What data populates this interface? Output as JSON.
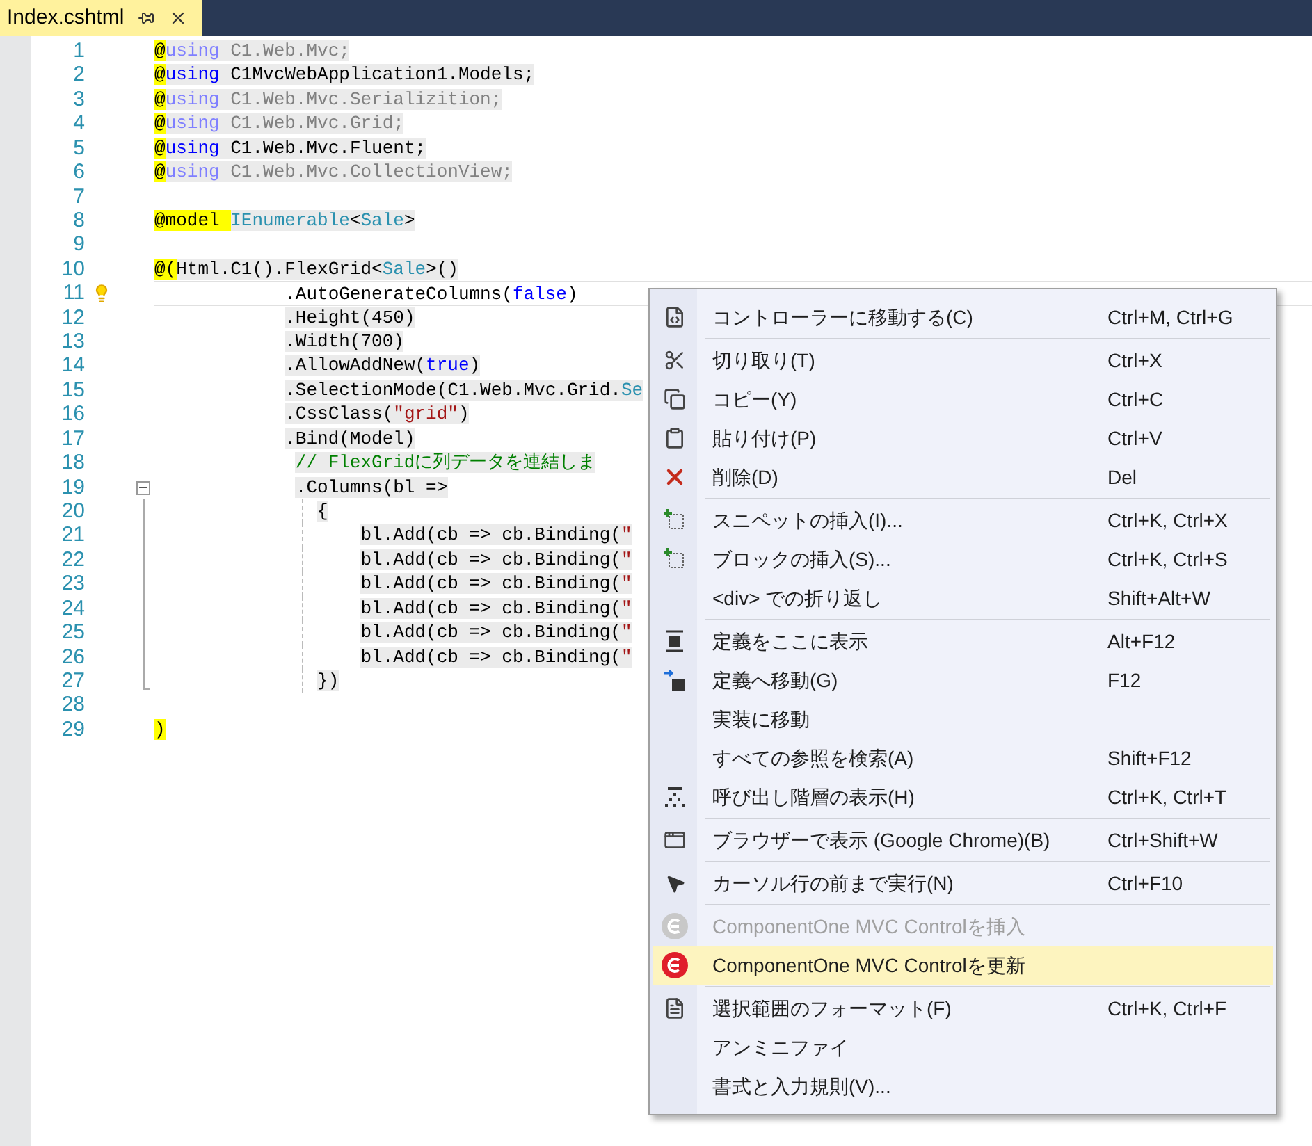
{
  "tab": {
    "title": "Index.cshtml",
    "selected": true
  },
  "code_lines": [
    {
      "number": "1",
      "current": false,
      "tokens": [
        {
          "kind": "razor",
          "text": "@"
        },
        {
          "kind": "keyword_dim",
          "text": "using"
        },
        {
          "kind": "dim",
          "text": " C1.Web.Mvc;"
        }
      ]
    },
    {
      "number": "2",
      "current": false,
      "tokens": [
        {
          "kind": "razor",
          "text": "@"
        },
        {
          "kind": "keyword",
          "text": "using"
        },
        {
          "kind": "plain",
          "text": " C1MvcWebApplication1.Models;"
        }
      ]
    },
    {
      "number": "3",
      "current": false,
      "tokens": [
        {
          "kind": "razor",
          "text": "@"
        },
        {
          "kind": "keyword_dim",
          "text": "using"
        },
        {
          "kind": "dim",
          "text": " C1.Web.Mvc.Serializition;"
        }
      ]
    },
    {
      "number": "4",
      "current": false,
      "tokens": [
        {
          "kind": "razor",
          "text": "@"
        },
        {
          "kind": "keyword_dim",
          "text": "using"
        },
        {
          "kind": "dim",
          "text": " C1.Web.Mvc.Grid;"
        }
      ]
    },
    {
      "number": "5",
      "current": false,
      "tokens": [
        {
          "kind": "razor",
          "text": "@"
        },
        {
          "kind": "keyword",
          "text": "using"
        },
        {
          "kind": "plain",
          "text": " C1.Web.Mvc.Fluent;"
        }
      ]
    },
    {
      "number": "6",
      "current": false,
      "tokens": [
        {
          "kind": "razor",
          "text": "@"
        },
        {
          "kind": "keyword_dim",
          "text": "using"
        },
        {
          "kind": "dim",
          "text": " C1.Web.Mvc.CollectionView;"
        }
      ]
    },
    {
      "number": "7",
      "current": false
    },
    {
      "number": "8",
      "current": false,
      "tokens": [
        {
          "kind": "razor",
          "text": "@model "
        },
        {
          "kind": "type",
          "text": "IEnumerable"
        },
        {
          "kind": "plain",
          "text": "<"
        },
        {
          "kind": "type",
          "text": "Sale"
        },
        {
          "kind": "plain",
          "text": ">"
        }
      ]
    },
    {
      "number": "9",
      "current": false
    },
    {
      "number": "10",
      "current": false,
      "tokens": [
        {
          "kind": "razor",
          "text": "@("
        },
        {
          "kind": "plain",
          "text": "Html.C1().FlexGrid<"
        },
        {
          "kind": "type",
          "text": "Sale"
        },
        {
          "kind": "plain",
          "text": ">()"
        }
      ]
    },
    {
      "number": "11",
      "current": true,
      "lightbulb": true,
      "tokens": [
        {
          "kind": "plain",
          "text": "            .AutoGenerateColumns("
        },
        {
          "kind": "keyword",
          "text": "false"
        },
        {
          "kind": "plain",
          "text": ")"
        }
      ]
    },
    {
      "number": "12",
      "current": false,
      "tokens": [
        {
          "kind": "plain",
          "text": "            .Height(450)"
        }
      ]
    },
    {
      "number": "13",
      "current": false,
      "tokens": [
        {
          "kind": "plain",
          "text": "            .Width(700)"
        }
      ]
    },
    {
      "number": "14",
      "current": false,
      "tokens": [
        {
          "kind": "plain",
          "text": "            .AllowAddNew("
        },
        {
          "kind": "keyword",
          "text": "true"
        },
        {
          "kind": "plain",
          "text": ")"
        }
      ]
    },
    {
      "number": "15",
      "current": false,
      "tokens": [
        {
          "kind": "plain",
          "text": "            .SelectionMode(C1.Web.Mvc.Grid."
        },
        {
          "kind": "type",
          "text": "Se"
        }
      ]
    },
    {
      "number": "16",
      "current": false,
      "tokens": [
        {
          "kind": "plain",
          "text": "            .CssClass("
        },
        {
          "kind": "string",
          "text": "\"grid\""
        },
        {
          "kind": "plain",
          "text": ")"
        }
      ]
    },
    {
      "number": "17",
      "current": false,
      "tokens": [
        {
          "kind": "plain",
          "text": "            .Bind(Model)"
        }
      ]
    },
    {
      "number": "18",
      "current": false,
      "tokens": [
        {
          "kind": "comment",
          "text": "             // FlexGridに列データを連結しま"
        }
      ]
    },
    {
      "number": "19",
      "current": false,
      "kind": "fold_start",
      "tokens": [
        {
          "kind": "plain",
          "text": "             .Columns(bl =>"
        }
      ]
    },
    {
      "number": "20",
      "current": false,
      "kind": "fold_body",
      "tokens": [
        {
          "kind": "plain",
          "text": "               {"
        }
      ]
    },
    {
      "number": "21",
      "current": false,
      "kind": "fold_body",
      "tokens": [
        {
          "kind": "plain",
          "text": "                   bl.Add(cb => cb.Binding("
        },
        {
          "kind": "string",
          "text": "\""
        }
      ]
    },
    {
      "number": "22",
      "current": false,
      "kind": "fold_body",
      "tokens": [
        {
          "kind": "plain",
          "text": "                   bl.Add(cb => cb.Binding("
        },
        {
          "kind": "string",
          "text": "\""
        }
      ]
    },
    {
      "number": "23",
      "current": false,
      "kind": "fold_body",
      "tokens": [
        {
          "kind": "plain",
          "text": "                   bl.Add(cb => cb.Binding("
        },
        {
          "kind": "string",
          "text": "\""
        }
      ]
    },
    {
      "number": "24",
      "current": false,
      "kind": "fold_body",
      "tokens": [
        {
          "kind": "plain",
          "text": "                   bl.Add(cb => cb.Binding("
        },
        {
          "kind": "string",
          "text": "\""
        }
      ]
    },
    {
      "number": "25",
      "current": false,
      "kind": "fold_body",
      "tokens": [
        {
          "kind": "plain",
          "text": "                   bl.Add(cb => cb.Binding("
        },
        {
          "kind": "string",
          "text": "\""
        }
      ]
    },
    {
      "number": "26",
      "current": false,
      "kind": "fold_body",
      "tokens": [
        {
          "kind": "plain",
          "text": "                   bl.Add(cb => cb.Binding("
        },
        {
          "kind": "string",
          "text": "\""
        }
      ]
    },
    {
      "number": "27",
      "current": false,
      "kind": "fold_end",
      "tokens": [
        {
          "kind": "plain",
          "text": "               })"
        }
      ]
    },
    {
      "number": "28",
      "current": false
    },
    {
      "number": "29",
      "current": false,
      "tokens": [
        {
          "kind": "razor",
          "text": ")"
        }
      ]
    }
  ],
  "context_menu": {
    "groups": [
      [
        {
          "label": "コントローラーに移動する(C)",
          "shortcut": "Ctrl+M, Ctrl+G",
          "disabled": false,
          "selected": false
        }
      ],
      [
        {
          "label": "切り取り(T)",
          "shortcut": "Ctrl+X",
          "disabled": false,
          "selected": false
        },
        {
          "label": "コピー(Y)",
          "shortcut": "Ctrl+C",
          "disabled": false,
          "selected": false
        },
        {
          "label": "貼り付け(P)",
          "shortcut": "Ctrl+V",
          "disabled": false,
          "selected": false
        },
        {
          "label": "削除(D)",
          "shortcut": "Del",
          "disabled": false,
          "selected": false
        }
      ],
      [
        {
          "label": "スニペットの挿入(I)...",
          "shortcut": "Ctrl+K, Ctrl+X",
          "disabled": false,
          "selected": false
        },
        {
          "label": "ブロックの挿入(S)...",
          "shortcut": "Ctrl+K, Ctrl+S",
          "disabled": false,
          "selected": false
        },
        {
          "label": "<div> での折り返し",
          "shortcut": "Shift+Alt+W",
          "disabled": false,
          "selected": false
        }
      ],
      [
        {
          "label": "定義をここに表示",
          "shortcut": "Alt+F12",
          "disabled": false,
          "selected": false
        },
        {
          "label": "定義へ移動(G)",
          "shortcut": "F12",
          "disabled": false,
          "selected": false
        },
        {
          "label": "実装に移動",
          "disabled": false,
          "selected": false
        },
        {
          "label": "すべての参照を検索(A)",
          "shortcut": "Shift+F12",
          "disabled": false,
          "selected": false
        },
        {
          "label": "呼び出し階層の表示(H)",
          "shortcut": "Ctrl+K, Ctrl+T",
          "disabled": false,
          "selected": false
        }
      ],
      [
        {
          "label": "ブラウザーで表示 (Google Chrome)(B)",
          "shortcut": "Ctrl+Shift+W",
          "disabled": false,
          "selected": false
        }
      ],
      [
        {
          "label": "カーソル行の前まで実行(N)",
          "shortcut": "Ctrl+F10",
          "disabled": false,
          "selected": false
        }
      ],
      [
        {
          "label": "ComponentOne MVC Controlを挿入",
          "disabled": true,
          "selected": false
        },
        {
          "label": "ComponentOne MVC Controlを更新",
          "disabled": false,
          "selected": true
        }
      ],
      [
        {
          "label": "選択範囲のフォーマット(F)",
          "shortcut": "Ctrl+K, Ctrl+F",
          "disabled": false,
          "selected": false
        },
        {
          "label": "アンミニファイ",
          "disabled": false,
          "selected": false
        },
        {
          "label": "書式と入力規則(V)...",
          "disabled": false,
          "selected": false
        }
      ]
    ]
  }
}
